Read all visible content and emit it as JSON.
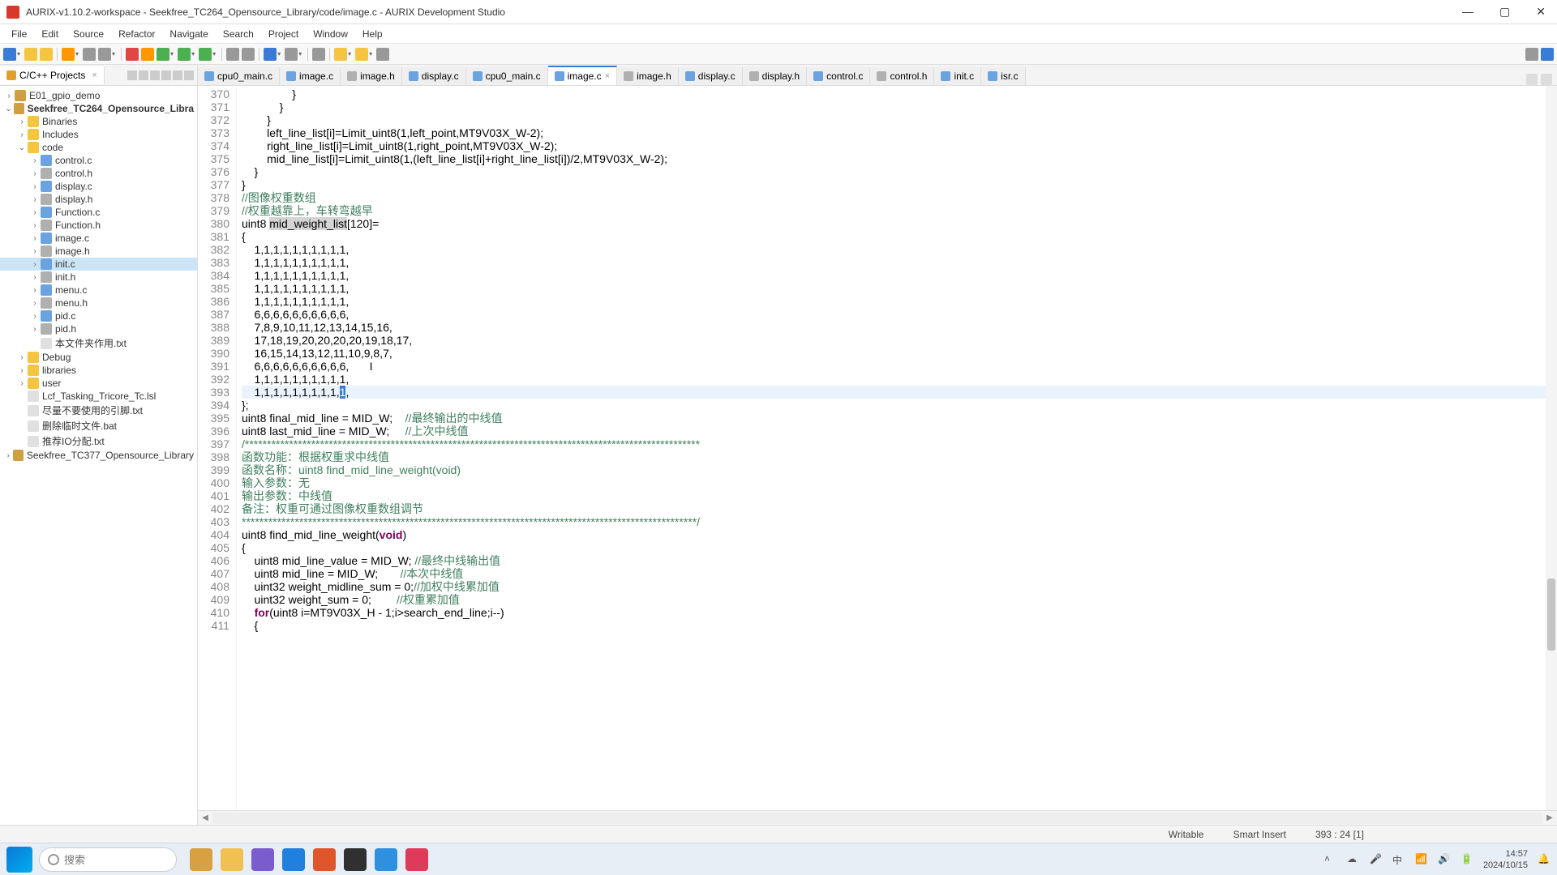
{
  "window": {
    "title": "AURIX-v1.10.2-workspace - Seekfree_TC264_Opensource_Library/code/image.c - AURIX Development Studio"
  },
  "menu": {
    "file": "File",
    "edit": "Edit",
    "source": "Source",
    "refactor": "Refactor",
    "navigate": "Navigate",
    "search": "Search",
    "project": "Project",
    "window": "Window",
    "help": "Help"
  },
  "sidebar": {
    "tab_label": "C/C++ Projects",
    "tree": {
      "p0": "E01_gpio_demo",
      "p1": "Seekfree_TC264_Opensource_Libra",
      "p1_children": {
        "binaries": "Binaries",
        "includes": "Includes",
        "code": "code",
        "code_children": {
          "control_c": "control.c",
          "control_h": "control.h",
          "display_c": "display.c",
          "display_h": "display.h",
          "function_c": "Function.c",
          "function_h": "Function.h",
          "image_c": "image.c",
          "image_h": "image.h",
          "init_c": "init.c",
          "init_h": "init.h",
          "menu_c": "menu.c",
          "menu_h": "menu.h",
          "pid_c": "pid.c",
          "pid_h": "pid.h",
          "txtfile": "本文件夹作用.txt"
        },
        "debug": "Debug",
        "libraries": "libraries",
        "user": "user",
        "lsl": "Lcf_Tasking_Tricore_Tc.lsl",
        "txt1": "尽量不要使用的引脚.txt",
        "bat": "删除临时文件.bat",
        "txt2": "推荐IO分配.txt"
      },
      "p2": "Seekfree_TC377_Opensource_Library"
    }
  },
  "editor": {
    "tabs": [
      {
        "label": "cpu0_main.c",
        "type": "c"
      },
      {
        "label": "image.c",
        "type": "c"
      },
      {
        "label": "image.h",
        "type": "h"
      },
      {
        "label": "display.c",
        "type": "c"
      },
      {
        "label": "cpu0_main.c",
        "type": "c"
      },
      {
        "label": "image.c",
        "type": "c",
        "active": true
      },
      {
        "label": "image.h",
        "type": "h"
      },
      {
        "label": "display.c",
        "type": "c"
      },
      {
        "label": "display.h",
        "type": "h"
      },
      {
        "label": "control.c",
        "type": "c"
      },
      {
        "label": "control.h",
        "type": "h"
      },
      {
        "label": "init.c",
        "type": "c"
      },
      {
        "label": "isr.c",
        "type": "c"
      }
    ],
    "first_line": 370,
    "lines": {
      "l370": "                }",
      "l371": "            }",
      "l372": "        }",
      "l373": "        left_line_list[i]=Limit_uint8(1,left_point,MT9V03X_W-2);",
      "l374": "        right_line_list[i]=Limit_uint8(1,right_point,MT9V03X_W-2);",
      "l375": "        mid_line_list[i]=Limit_uint8(1,(left_line_list[i]+right_line_list[i])/2,MT9V03X_W-2);",
      "l376": "    }",
      "l377": "}",
      "l378_cm": "//图像权重数组",
      "l379_cm": "//权重越靠上，车转弯越早",
      "l380_a": "uint8 ",
      "l380_b": "mid_weight_list",
      "l380_c": "[120]=",
      "l381": "{",
      "l382": "    1,1,1,1,1,1,1,1,1,1,",
      "l383": "    1,1,1,1,1,1,1,1,1,1,",
      "l384": "    1,1,1,1,1,1,1,1,1,1,",
      "l385": "    1,1,1,1,1,1,1,1,1,1,",
      "l386": "    1,1,1,1,1,1,1,1,1,1,",
      "l387": "    6,6,6,6,6,6,6,6,6,6,",
      "l388": "    7,8,9,10,11,12,13,14,15,16,",
      "l389": "    17,18,19,20,20,20,20,19,18,17,",
      "l390": "    16,15,14,13,12,11,10,9,8,7,",
      "l391": "    6,6,6,6,6,6,6,6,6,6,",
      "l392": "    1,1,1,1,1,1,1,1,1,1,",
      "l393_a": "    1,1,1,1,1,1,1,1,1,",
      "l393_sel": "1",
      "l393_b": ",",
      "l394": "};",
      "l395_a": "uint8 final_mid_line = MID_W;    ",
      "l395_b": "//最终输出的中线值",
      "l396_a": "uint8 last_mid_line = MID_W;     ",
      "l396_b": "//上次中线值",
      "l397_cm": "/*******************************************************************************************************",
      "l398_cm": "函数功能：根据权重求中线值",
      "l399_cm": "函数名称：uint8 find_mid_line_weight(void)",
      "l400_cm": "输入参数：无",
      "l401_cm": "输出参数：中线值",
      "l402_cm": "备注：权重可通过图像权重数组调节",
      "l403_cm": "*******************************************************************************************************/",
      "l404_a": "uint8 find_mid_line_weight(",
      "l404_b": "void",
      "l404_c": ")",
      "l405": "{",
      "l406_a": "    uint8 mid_line_value = MID_W; ",
      "l406_b": "//最终中线输出值",
      "l407_a": "    uint8 mid_line = MID_W;       ",
      "l407_b": "//本次中线值",
      "l408_a": "    uint32 weight_midline_sum = 0;",
      "l408_b": "//加权中线累加值",
      "l409_a": "    uint32 weight_sum = 0;        ",
      "l409_b": "//权重累加值",
      "l410_a": "    ",
      "l410_b": "for",
      "l410_c": "(uint8 i=MT9V03X_H - 1;i>search_end_line;i--)",
      "l411": "    {"
    }
  },
  "status": {
    "writable": "Writable",
    "insert": "Smart Insert",
    "pos": "393 : 24 [1]"
  },
  "taskbar": {
    "search_placeholder": "搜索",
    "time": "14:57",
    "date": "2024/10/15"
  }
}
